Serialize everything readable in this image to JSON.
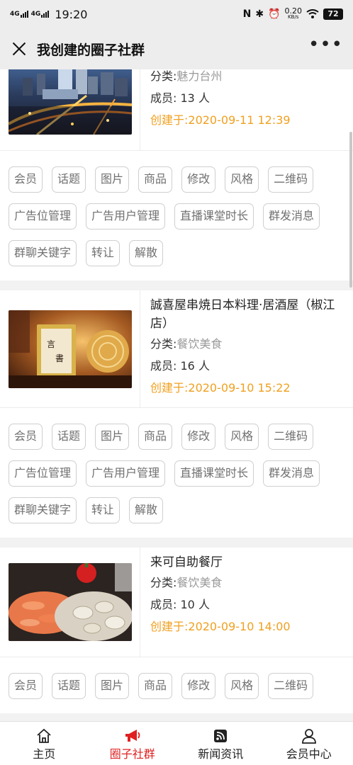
{
  "status_bar": {
    "signal1": "4G",
    "signal2": "4G",
    "time": "19:20",
    "nfc": "N",
    "speed_value": "0.20",
    "speed_unit": "KB/s",
    "battery": "72"
  },
  "header": {
    "title": "我创建的圈子社群"
  },
  "groups": [
    {
      "name": "",
      "category_label": "分类:",
      "category": "魅力台州",
      "members_label": "成员:",
      "members": "13 人",
      "created": "创建于:2020-09-11 12:39",
      "image": "city-night-photo"
    },
    {
      "name": "誠喜屋串焼日本料理·居酒屋（椒江店）",
      "category_label": "分类:",
      "category": "餐饮美食",
      "members_label": "成员:",
      "members": "16 人",
      "created": "创建于:2020-09-10 15:22",
      "image": "izakaya-photo"
    },
    {
      "name": "来可自助餐厅",
      "category_label": "分类:",
      "category": "餐饮美食",
      "members_label": "成员:",
      "members": "10 人",
      "created": "创建于:2020-09-10 14:00",
      "image": "seafood-buffet-photo"
    }
  ],
  "action_buttons": [
    "会员",
    "话题",
    "图片",
    "商品",
    "修改",
    "风格",
    "二维码",
    "广告位管理",
    "广告用户管理",
    "直播课堂时长",
    "群发消息",
    "群聊关键字",
    "转让",
    "解散"
  ],
  "tabs": [
    {
      "label": "主页",
      "icon": "home-icon",
      "active": false
    },
    {
      "label": "圈子社群",
      "icon": "megaphone-icon",
      "active": true
    },
    {
      "label": "新闻资讯",
      "icon": "rss-icon",
      "active": false
    },
    {
      "label": "会员中心",
      "icon": "user-icon",
      "active": false
    }
  ],
  "colors": {
    "accent_created": "#f0a020",
    "tab_active": "#e02020",
    "category_value": "#9a9a9a"
  }
}
